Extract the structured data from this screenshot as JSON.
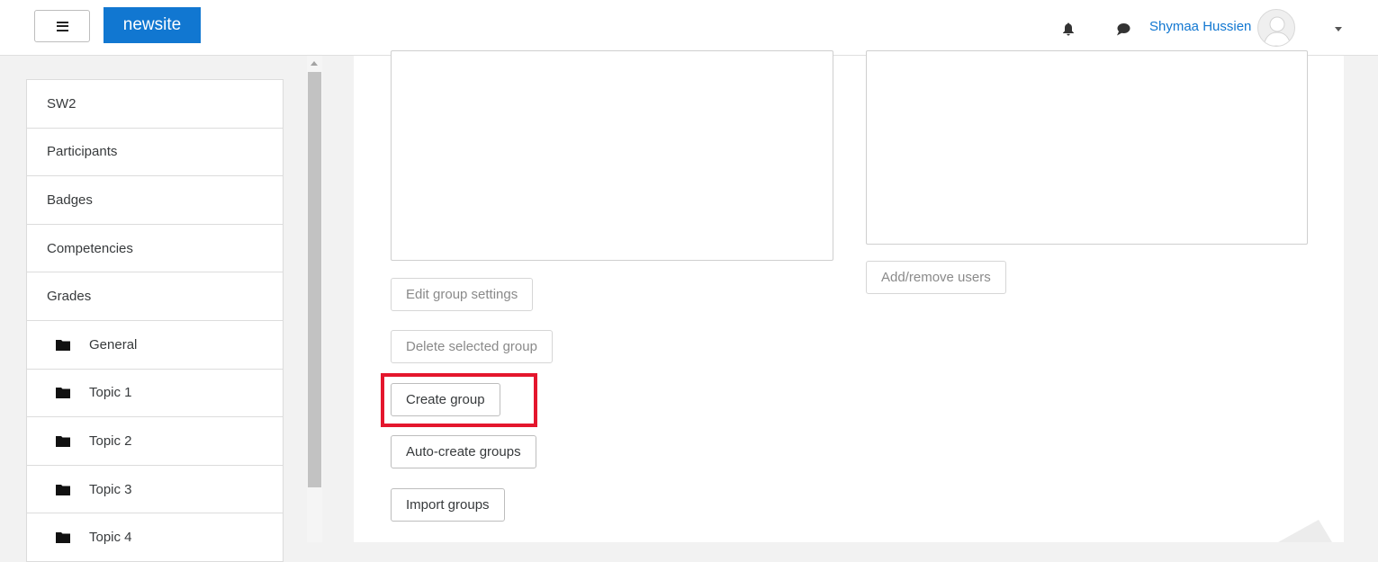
{
  "navbar": {
    "brand": "newsite",
    "user_name": "Shymaa Hussien",
    "icons": [
      "hamburger-icon",
      "bell-icon",
      "chat-icon",
      "avatar-icon",
      "caret-down-icon"
    ]
  },
  "drawer": {
    "items": [
      {
        "label": "SW2",
        "icon": ""
      },
      {
        "label": "Participants",
        "icon": ""
      },
      {
        "label": "Badges",
        "icon": ""
      },
      {
        "label": "Competencies",
        "icon": ""
      },
      {
        "label": "Grades",
        "icon": ""
      },
      {
        "label": "General",
        "icon": "folder-icon"
      },
      {
        "label": "Topic 1",
        "icon": "folder-icon"
      },
      {
        "label": "Topic 2",
        "icon": "folder-icon"
      },
      {
        "label": "Topic 3",
        "icon": "folder-icon"
      },
      {
        "label": "Topic 4",
        "icon": "folder-icon"
      }
    ]
  },
  "groups_panel": {
    "buttons": {
      "edit_group_settings": "Edit group settings",
      "delete_selected_group": "Delete selected group",
      "create_group": "Create group",
      "auto_create_groups": "Auto-create groups",
      "import_groups": "Import groups"
    }
  },
  "members_panel": {
    "buttons": {
      "add_remove_users": "Add/remove users"
    }
  },
  "colors": {
    "brand": "#1177d1",
    "highlight": "#e4162d"
  }
}
